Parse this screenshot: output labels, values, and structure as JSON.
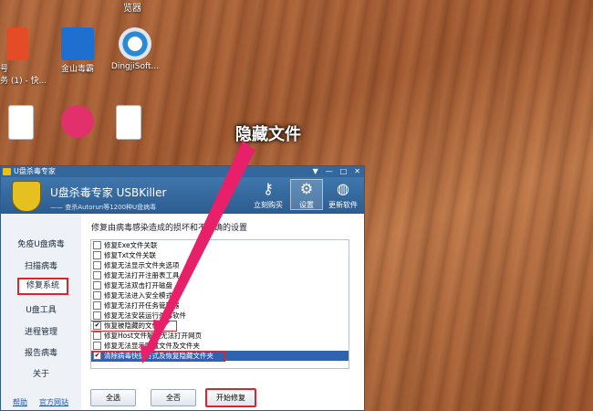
{
  "desktop": {
    "top_text": "览器",
    "icons": [
      {
        "label": "号\n务 (1) - 快...",
        "color": "#e34c26"
      },
      {
        "label": "金山毒霸",
        "color": "#1e6fd0"
      },
      {
        "label": "DingjiSoft...",
        "color": "#d0d8e0"
      },
      {
        "label": "",
        "color": "#ffffff"
      },
      {
        "label": "",
        "color": "#e1306c"
      },
      {
        "label": "",
        "color": "#ffffff"
      }
    ],
    "annotation": "隐藏文件"
  },
  "window": {
    "title": "U盘杀毒专家",
    "controls": [
      "▼",
      "—",
      "□",
      "✕"
    ],
    "brand": "U盘杀毒专家   USBKiller",
    "tagline": "—— 查杀Autorun等1200种U盘病毒",
    "header_buttons": [
      {
        "label": "立刻购买",
        "icon": "key-icon"
      },
      {
        "label": "设置",
        "icon": "gear-icon"
      },
      {
        "label": "更新软件",
        "icon": "globe-icon"
      }
    ],
    "sidebar": [
      "免疫U盘病毒",
      "扫描病毒",
      "修复系统",
      "U盘工具",
      "进程管理",
      "报告病毒",
      "关于"
    ],
    "footer_links": [
      "帮助",
      "官方网站"
    ],
    "section_title": "修复由病毒感染造成的损坏和不正确的设置",
    "options": [
      {
        "label": "修复Exe文件关联",
        "checked": false
      },
      {
        "label": "修复Txt文件关联",
        "checked": false
      },
      {
        "label": "修复无法显示文件夹选项",
        "checked": false
      },
      {
        "label": "修复无法打开注册表工具",
        "checked": false
      },
      {
        "label": "修复无法双击打开磁盘",
        "checked": false
      },
      {
        "label": "修复无法进入安全模式",
        "checked": false
      },
      {
        "label": "修复无法打开任务管理器",
        "checked": false
      },
      {
        "label": "修复无法安装运行杀毒软件",
        "checked": false
      },
      {
        "label": "恢复被隐藏的文件",
        "checked": true
      },
      {
        "label": "修复Host文件解决无法打开网页",
        "checked": false
      },
      {
        "label": "修复无法显示隐藏文件及文件夹",
        "checked": false
      },
      {
        "label": "清除病毒快捷方式及恢复隐藏文件夹",
        "checked": true
      }
    ],
    "buttons": {
      "select_all": "全选",
      "select_none": "全否",
      "start": "开始修复"
    }
  }
}
